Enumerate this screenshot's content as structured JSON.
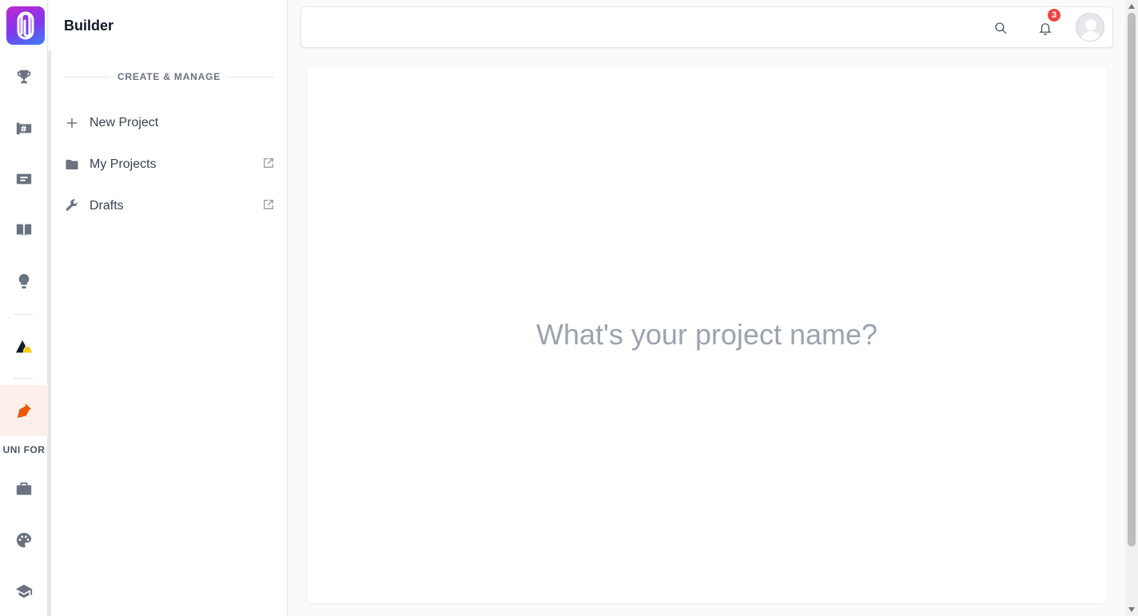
{
  "sidebar": {
    "title": "Builder",
    "section_heading": "CREATE & MANAGE",
    "items": [
      {
        "label": "New Project",
        "icon": "plus-icon",
        "external": false
      },
      {
        "label": "My Projects",
        "icon": "folder-icon",
        "external": true
      },
      {
        "label": "Drafts",
        "icon": "wrench-icon",
        "external": true
      }
    ]
  },
  "rail": {
    "items": [
      "trophy-icon",
      "hashtag-board-icon",
      "article-icon",
      "book-icon",
      "lightbulb-icon",
      "triangle-logo-icon",
      "pen-nib-icon",
      "briefcase-icon",
      "palette-icon",
      "graduation-cap-icon"
    ],
    "active": "pen-nib-icon",
    "section_label": "UNI FOR"
  },
  "topbar": {
    "notification_count": "3"
  },
  "main": {
    "project_name_placeholder": "What's your project name?",
    "project_name_value": ""
  },
  "colors": {
    "accent": "#ea580c",
    "badge": "#ef4444",
    "logo_gradient": [
      "#c026d3",
      "#7c3aed",
      "#3b82f6"
    ]
  }
}
